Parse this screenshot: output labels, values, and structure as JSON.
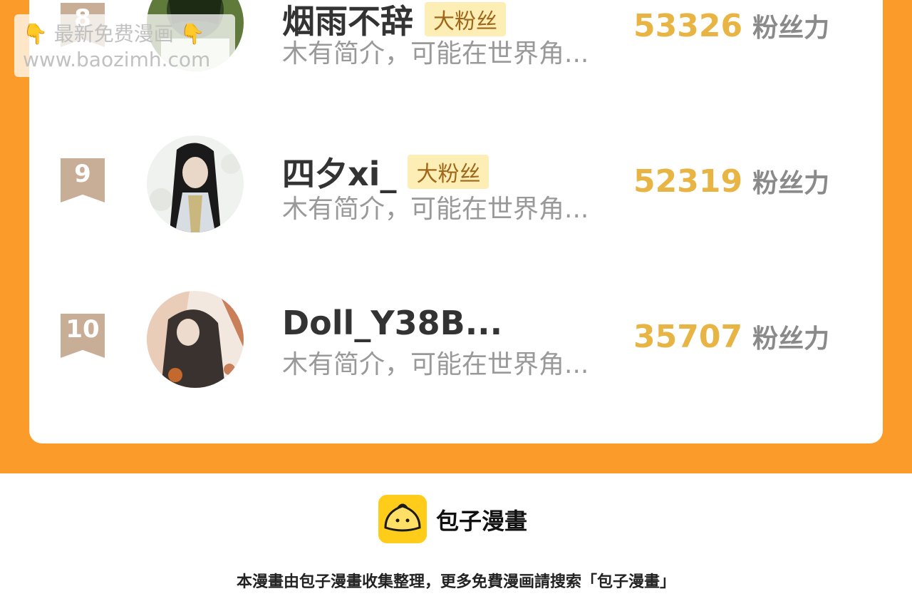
{
  "ranking": [
    {
      "rank": "8",
      "name": "烟雨不辞",
      "badge": "大粉丝",
      "intro": "木有简介，可能在世界角...",
      "score": "53326",
      "unit": "粉丝力"
    },
    {
      "rank": "9",
      "name": "四夕xi_",
      "badge": "大粉丝",
      "intro": "木有简介，可能在世界角...",
      "score": "52319",
      "unit": "粉丝力"
    },
    {
      "rank": "10",
      "name": "Doll_Y38B...",
      "badge": "",
      "intro": "木有简介，可能在世界角...",
      "score": "35707",
      "unit": "粉丝力"
    }
  ],
  "watermark": {
    "line1": "最新免费漫画",
    "line2": "www.baozimh.com"
  },
  "footer": {
    "brand": "包子漫畫",
    "note": "本漫畫由包子漫畫收集整理，更多免費漫画請搜索「包子漫畫」"
  },
  "colors": {
    "band": "#fb9c2a",
    "score": "#e8b443",
    "badge_bg": "#fdeeb5",
    "logo": "#ffcc1a"
  }
}
